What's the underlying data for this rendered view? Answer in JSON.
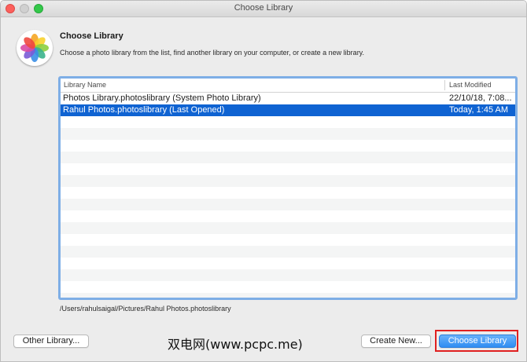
{
  "window": {
    "title": "Choose Library",
    "controls": [
      "close",
      "minimize",
      "zoom"
    ]
  },
  "header": {
    "icon": "photos-app-icon",
    "heading": "Choose Library",
    "description": "Choose a photo library from the list, find another library on your computer, or create a new library."
  },
  "table": {
    "columns": [
      "Library Name",
      "Last Modified"
    ],
    "rows": [
      {
        "name": "Photos Library.photoslibrary (System Photo Library)",
        "modified": "22/10/18, 7:08...",
        "selected": false
      },
      {
        "name": "Rahul Photos.photoslibrary (Last Opened)",
        "modified": "Today, 1:45 AM",
        "selected": true
      }
    ]
  },
  "path": "/Users/rahulsaigal/Pictures/Rahul Photos.photoslibrary",
  "buttons": {
    "other_library": "Other Library...",
    "create_new": "Create New...",
    "choose_library": "Choose Library"
  },
  "watermark": "双电网(www.pcpc.me)",
  "colors": {
    "selection": "#0f63d2",
    "focus_ring": "#7eaee6",
    "primary_button": "#2f8df2",
    "annotation_box": "#e02020"
  }
}
